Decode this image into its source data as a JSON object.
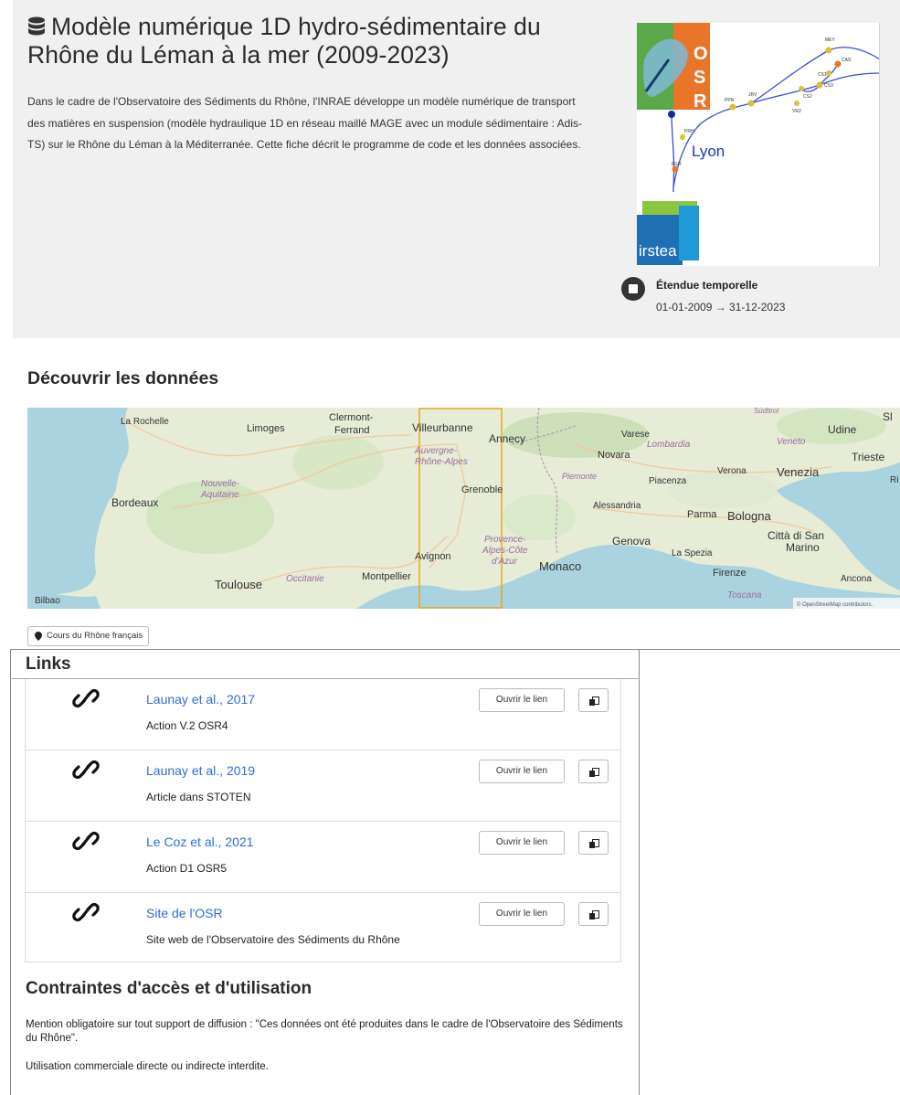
{
  "header": {
    "title": "Modèle numérique 1D hydro-sédimentaire du Rhône du Léman à la mer (2009-2023)",
    "description": "Dans le cadre de l'Observatoire des Sédiments du Rhône, l'INRAE développe un modèle numérique de transport des matières en suspension (modèle hydraulique 1D en réseau maillé MAGE avec un module sédimentaire : Adis-TS) sur le Rhône du Léman à la Méditerranée. Cette fiche décrit le programme de code et les données associées.",
    "thumbnail": {
      "logo_letters": [
        "O",
        "S",
        "R"
      ],
      "city_label": "Lyon",
      "partner_logo": "irstea",
      "station_labels": [
        "MEY",
        "CAS",
        "CS1",
        "CS2",
        "CS3",
        "JRV",
        "VR2",
        "PPN",
        "PRH",
        "FGR"
      ]
    }
  },
  "temporal": {
    "label": "Étendue temporelle",
    "range": "01-01-2009 → 31-12-2023"
  },
  "discover": {
    "title": "Découvrir les données",
    "map_labels": [
      "La Rochelle",
      "Limoges",
      "Clermont-",
      "Ferrand",
      "Villeurbanne",
      "Annecy",
      "Varese",
      "Udine",
      "Trieste",
      "Lombardia",
      "Veneto",
      "Novara",
      "Verona",
      "Venezia",
      "Piemonte",
      "Piacenza",
      "Nouvelle-",
      "Aquitaine",
      "Bordeaux",
      "Auvergne-",
      "Rhône-Alpes",
      "Grenoble",
      "Alessandria",
      "Parma",
      "Bologna",
      "Genova",
      "Città di San",
      "Marino",
      "Provence-",
      "Alpes-Côte",
      "d'Azur",
      "Avignon",
      "Monaco",
      "La Spezia",
      "Firenze",
      "Montpellier",
      "Toulouse",
      "Occitanie",
      "Ancona",
      "Bilbao",
      "Toscana",
      "Sl",
      "Ri",
      "Südtirol"
    ],
    "attribution": "© OpenStreetMap contributors.",
    "legend_label": "Cours du Rhône français"
  },
  "links": {
    "title": "Links",
    "open_label": "Ouvrir le lien",
    "items": [
      {
        "title": "Launay et al., 2017",
        "subtitle": "Action V.2 OSR4"
      },
      {
        "title": "Launay et al., 2019",
        "subtitle": "Article dans STOTEN"
      },
      {
        "title": "Le Coz et al., 2021",
        "subtitle": "Action D1 OSR5"
      },
      {
        "title": "Site de l'OSR",
        "subtitle": "Site web de l'Observatoire des Sédiments du Rhône"
      }
    ]
  },
  "constraints": {
    "title": "Contraintes d'accès et d'utilisation",
    "mention": "Mention obligatoire sur tout support de diffusion : \"Ces données ont été produites dans le cadre de l'Observatoire des Sédiments du Rhône\".",
    "usage": "Utilisation commerciale directe ou indirecte interdite."
  },
  "colors": {
    "link": "#2a6fd8",
    "hero_bg": "#f0f0f0",
    "osr_orange": "#e8752a",
    "bbox_orange": "#e8a317"
  }
}
